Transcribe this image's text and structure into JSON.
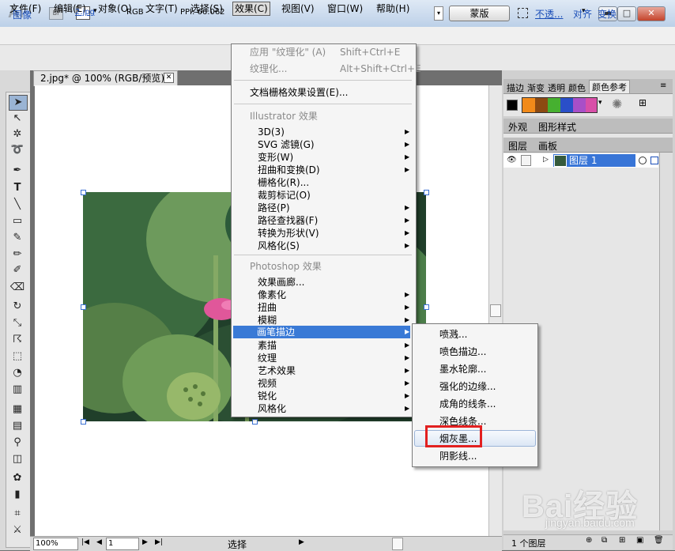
{
  "titlebar": {
    "app_logo": "Ai",
    "bridge": "Br",
    "dropdown": "▾",
    "min": "▬",
    "max": "□",
    "close": "✕"
  },
  "menubar": {
    "file": "文件(F)",
    "edit": "编辑(E)",
    "object": "对象(O)",
    "type": "文字(T)",
    "select": "选择(S)",
    "effect": "效果(C)",
    "view": "视图(V)",
    "window": "窗口(W)",
    "help": "帮助(H)"
  },
  "controlbar": {
    "image": "图像",
    "file": "2.jpg",
    "mode": "RGB",
    "ppi": "PPI: 66.062",
    "mask": "蒙版",
    "opacity": "不透...",
    "align": "对齐",
    "transform": "变换"
  },
  "document": {
    "tab": "2.jpg* @ 100% (RGB/预览)",
    "zoom": "100%",
    "page": "1",
    "status": "选择"
  },
  "effect_menu": {
    "apply": "应用 \"纹理化\" (A)",
    "apply_shortcut": "Shift+Ctrl+E",
    "texturize": "纹理化...",
    "texturize_shortcut": "Alt+Shift+Ctrl+E",
    "raster_settings": "文档栅格效果设置(E)...",
    "section_illustrator": "Illustrator 效果",
    "illustrator_items": [
      "3D(3)",
      "SVG 滤镜(G)",
      "变形(W)",
      "扭曲和变换(D)",
      "栅格化(R)...",
      "裁剪标记(O)",
      "路径(P)",
      "路径查找器(F)",
      "转换为形状(V)",
      "风格化(S)"
    ],
    "section_photoshop": "Photoshop 效果",
    "photoshop_items": [
      "效果画廊...",
      "像素化",
      "扭曲",
      "模糊",
      "画笔描边",
      "素描",
      "纹理",
      "艺术效果",
      "视频",
      "锐化",
      "风格化"
    ]
  },
  "brush_submenu": {
    "items": [
      "喷溅...",
      "喷色描边...",
      "墨水轮廓...",
      "强化的边缘...",
      "成角的线条...",
      "深色线条...",
      "烟灰墨...",
      "阴影线..."
    ],
    "highlighted": "烟灰墨..."
  },
  "panels": {
    "swatch_tabs": [
      "描边",
      "渐变",
      "透明",
      "颜色",
      "颜色参考"
    ],
    "appearance_tabs": [
      "外观",
      "图形样式"
    ],
    "layer_tabs": [
      "图层",
      "画板"
    ],
    "layer_name": "图层 1",
    "layer_count": "1 个图层",
    "swatch_colors": [
      "#f28a1a",
      "#8c4a12",
      "#46b030",
      "#2a4fc8",
      "#a84fc8",
      "#d84fa8"
    ]
  },
  "watermark": {
    "brand": "Bai经验",
    "url": "jingyan.baidu.com"
  }
}
